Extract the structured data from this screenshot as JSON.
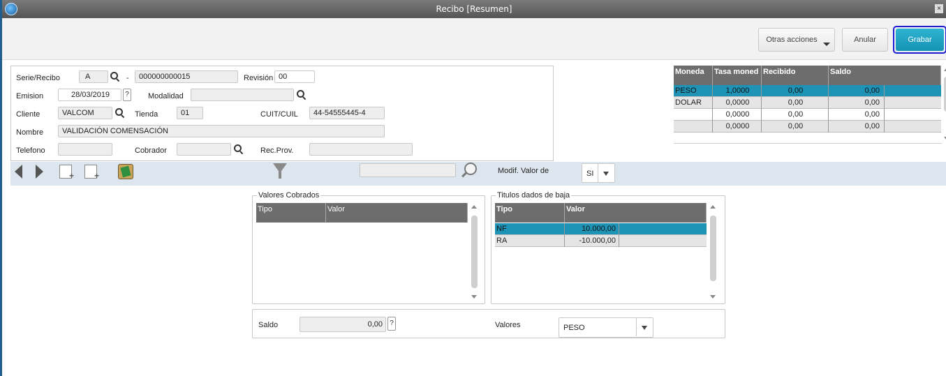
{
  "window": {
    "title": "Recibo [Resumen]",
    "close": "×"
  },
  "toolbar": {
    "otras": "Otras acciones",
    "anular": "Anular",
    "grabar": "Grabar"
  },
  "form": {
    "serie_label": "Serie/Recibo",
    "serie_value": "A",
    "dash": "-",
    "recibo_value": "000000000015",
    "revision_label": "Revisión",
    "revision_value": "00",
    "emision_label": "Emision",
    "emision_value": "28/03/2019",
    "help": "?",
    "modalidad_label": "Modalidad",
    "modalidad_value": "",
    "cliente_label": "Cliente",
    "cliente_value": "VALCOM",
    "tienda_label": "Tienda",
    "tienda_value": "01",
    "cuit_label": "CUIT/CUIL",
    "cuit_value": "44-54555445-4",
    "nombre_label": "Nombre",
    "nombre_value": "VALIDACIÓN COMENSACIÓN",
    "telefono_label": "Telefono",
    "telefono_value": "",
    "cobrador_label": "Cobrador",
    "cobrador_value": "",
    "recprov_label": "Rec.Prov.",
    "recprov_value": ""
  },
  "moneda_grid": {
    "headers": [
      "Moneda",
      "Tasa moned",
      "Recibido",
      "Saldo"
    ],
    "rows": [
      [
        "PESO",
        "1,0000",
        "0,00",
        "0,00"
      ],
      [
        "DOLAR",
        "0,0000",
        "0,00",
        "0,00"
      ],
      [
        "",
        "0,0000",
        "0,00",
        "0,00"
      ],
      [
        "",
        "0,0000",
        "0,00",
        "0,00"
      ]
    ]
  },
  "iconbar": {
    "modif_label": "Modif. Valor de",
    "modif_value": "SI"
  },
  "valores_cobrados": {
    "legend": "Valores Cobrados",
    "headers": [
      "Tipo",
      "Valor"
    ]
  },
  "titulos": {
    "legend": "Titulos dados de baja",
    "headers": [
      "Tipo",
      "Valor"
    ],
    "rows": [
      [
        "NF",
        "10.000,00"
      ],
      [
        "RA",
        "-10.000,00"
      ]
    ]
  },
  "footer": {
    "saldo_label": "Saldo",
    "saldo_value": "0,00",
    "help": "?",
    "valores_label": "Valores",
    "valores_value": "PESO"
  }
}
